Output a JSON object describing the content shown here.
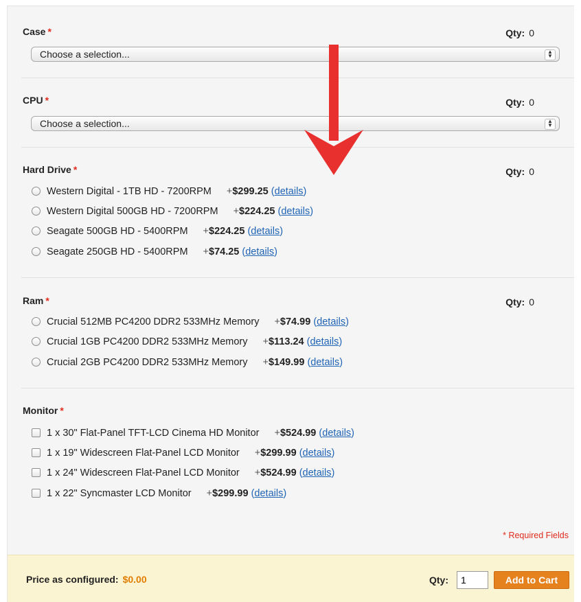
{
  "sections": {
    "case": {
      "label": "Case",
      "required_mark": "*",
      "qty_label": "Qty:",
      "qty": "0",
      "select_value": "Choose a selection..."
    },
    "cpu": {
      "label": "CPU",
      "required_mark": "*",
      "qty_label": "Qty:",
      "qty": "0",
      "select_value": "Choose a selection..."
    },
    "hard_drive": {
      "label": "Hard Drive",
      "required_mark": "*",
      "qty_label": "Qty:",
      "qty": "0",
      "options": [
        {
          "name": "Western Digital - 1TB HD - 7200RPM",
          "plus": "+",
          "price": "$299.25",
          "open": "(",
          "link": "details",
          "close": ")"
        },
        {
          "name": "Western Digital 500GB HD - 7200RPM",
          "plus": "+",
          "price": "$224.25",
          "open": "(",
          "link": "details",
          "close": ")"
        },
        {
          "name": "Seagate 500GB HD - 5400RPM",
          "plus": "+",
          "price": "$224.25",
          "open": "(",
          "link": "details",
          "close": ")"
        },
        {
          "name": "Seagate 250GB HD - 5400RPM",
          "plus": "+",
          "price": "$74.25",
          "open": "(",
          "link": "details",
          "close": ")"
        }
      ]
    },
    "ram": {
      "label": "Ram",
      "required_mark": "*",
      "qty_label": "Qty:",
      "qty": "0",
      "options": [
        {
          "name": "Crucial 512MB PC4200 DDR2 533MHz Memory",
          "plus": "+",
          "price": "$74.99",
          "open": "(",
          "link": "details",
          "close": ")"
        },
        {
          "name": "Crucial 1GB PC4200 DDR2 533MHz Memory",
          "plus": "+",
          "price": "$113.24",
          "open": "(",
          "link": "details",
          "close": ")"
        },
        {
          "name": "Crucial 2GB PC4200 DDR2 533MHz Memory",
          "plus": "+",
          "price": "$149.99",
          "open": "(",
          "link": "details",
          "close": ")"
        }
      ]
    },
    "monitor": {
      "label": "Monitor",
      "required_mark": "*",
      "options": [
        {
          "name": "1 x 30\" Flat-Panel TFT-LCD Cinema HD Monitor",
          "plus": "+",
          "price": "$524.99",
          "open": "(",
          "link": "details",
          "close": ")"
        },
        {
          "name": "1 x 19\" Widescreen Flat-Panel LCD Monitor",
          "plus": "+",
          "price": "$299.99",
          "open": "(",
          "link": "details",
          "close": ")"
        },
        {
          "name": "1 x 24\" Widescreen Flat-Panel LCD Monitor",
          "plus": "+",
          "price": "$524.99",
          "open": "(",
          "link": "details",
          "close": ")"
        },
        {
          "name": "1 x 22\" Syncmaster LCD Monitor",
          "plus": "+",
          "price": "$299.99",
          "open": "(",
          "link": "details",
          "close": ")"
        }
      ]
    }
  },
  "required_note": "* Required Fields",
  "footer": {
    "price_label": "Price as configured:",
    "price_value": "$0.00",
    "qty_label": "Qty:",
    "qty_value": "1",
    "add_to_cart": "Add to Cart"
  },
  "annotation": {
    "icon": "down-arrow-icon",
    "color": "#e8312f"
  },
  "colors": {
    "accent": "#e5821e",
    "required": "#e02b1d",
    "link": "#1f63b5",
    "price": "#e27d00"
  }
}
